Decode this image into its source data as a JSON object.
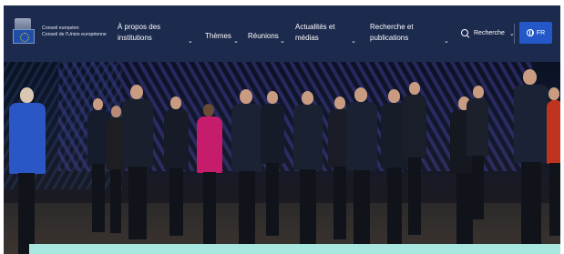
{
  "header": {
    "logo": {
      "line1": "Conseil européen",
      "line2": "Conseil de l'Union européenne"
    },
    "nav": [
      {
        "id": "apropos",
        "line1": "À propos des",
        "line2": "institutions"
      },
      {
        "id": "themes",
        "line1": "Thèmes",
        "line2": ""
      },
      {
        "id": "reunions",
        "line1": "Réunions",
        "line2": ""
      },
      {
        "id": "actualites",
        "line1": "Actualités et",
        "line2": "médias"
      },
      {
        "id": "recherche",
        "line1": "Recherche et",
        "line2": "publications"
      }
    ],
    "search_label": "Recherche",
    "language": "FR",
    "colors": {
      "header_bg": "#1c2a4d",
      "language_button": "#2458c9",
      "accent_bar": "#a8e6e0"
    }
  },
  "hero": {
    "description_icon": "group-photo"
  }
}
